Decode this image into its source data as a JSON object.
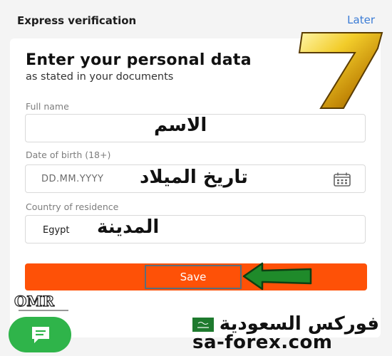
{
  "header": {
    "title": "Express verification",
    "later_link": "Later"
  },
  "form": {
    "heading": "Enter your personal data",
    "subheading": "as stated in your documents",
    "full_name": {
      "label": "Full name",
      "overlay_text": "الاسم"
    },
    "date_of_birth": {
      "label": "Date of birth (18+)",
      "placeholder": "DD.MM.YYYY",
      "overlay_text": "تاريخ الميلاد",
      "icon": "calendar-icon"
    },
    "country": {
      "label": "Country of residence",
      "value": "Egypt",
      "overlay_text": "المدينة"
    },
    "save_label": "Save"
  },
  "overlay": {
    "badge_number": "7",
    "logo_text": "OMR",
    "watermark_ar": "فوركس السعودية",
    "watermark_en": "sa-forex.com"
  },
  "colors": {
    "accent": "#fe5107",
    "link": "#3a7bd5",
    "chat": "#2fb44a"
  }
}
